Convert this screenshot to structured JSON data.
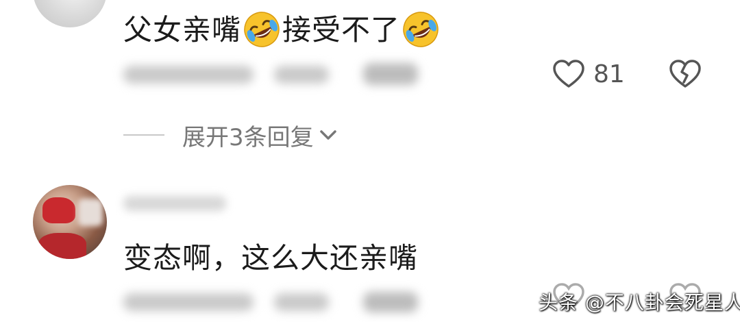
{
  "comments": [
    {
      "text_part1": "父女亲嘴",
      "text_part2": "接受不了",
      "emoji": "rolling-on-floor-laughing-icon",
      "like_count": "81",
      "expand_label": "展开3条回复"
    },
    {
      "text": "变态啊，这么大还亲嘴"
    }
  ],
  "watermark": "头条 @不八卦会死星人",
  "colors": {
    "text": "#1b1b1b",
    "meta": "#777777",
    "icon": "#555555"
  }
}
